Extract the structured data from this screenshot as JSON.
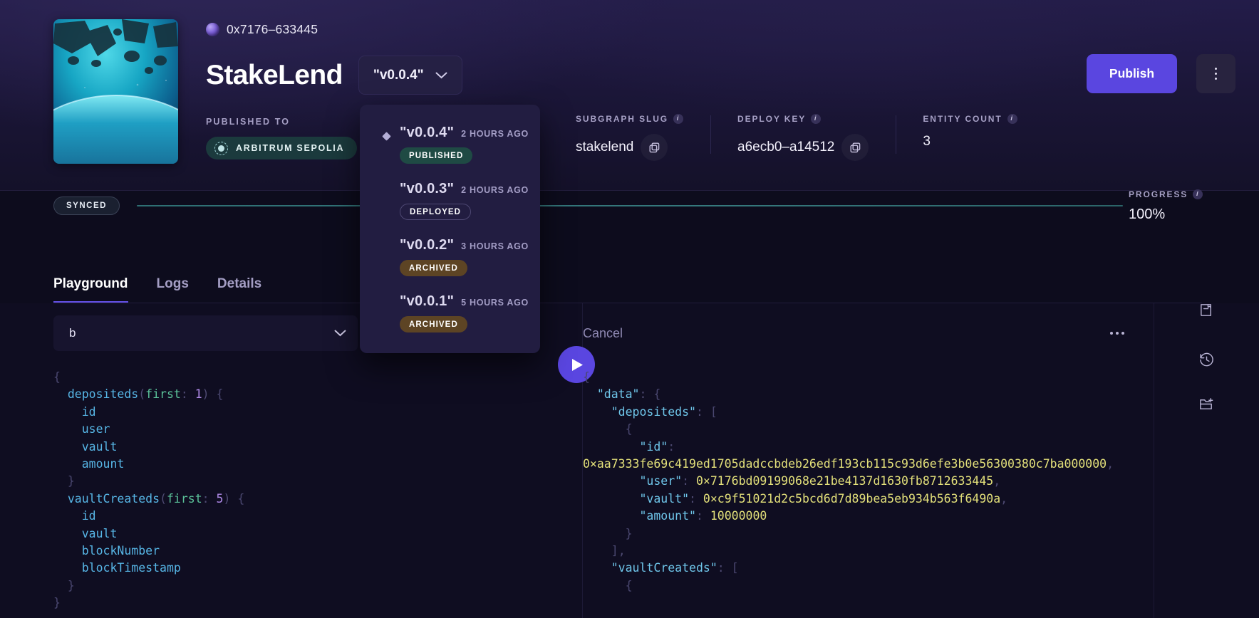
{
  "header": {
    "owner_id": "0x7176–633445",
    "owner_avatar_icon": "avatar-icon",
    "title": "StakeLend",
    "version_selector": {
      "value": "\"v0.0.4\"",
      "chevron_icon": "chevron-down-icon"
    },
    "published_to_label": "PUBLISHED TO",
    "network": {
      "name": "ARBITRUM SEPOLIA",
      "logo_icon": "arbitrum-logo-icon"
    },
    "publish_button": "Publish",
    "kebab_icon": "more-vertical-icon",
    "thumbnail_icon": "subgraph-thumbnail-image"
  },
  "meta": [
    {
      "label": "SUBGRAPH SLUG",
      "value": "stakelend",
      "info_icon": "info-icon",
      "copy_icon": "copy-icon",
      "has_copy": true
    },
    {
      "label": "DEPLOY KEY",
      "value": "a6ecb0–a14512",
      "info_icon": "info-icon",
      "copy_icon": "copy-icon",
      "has_copy": true
    },
    {
      "label": "ENTITY COUNT",
      "value": "3",
      "info_icon": "info-icon",
      "copy_icon": "copy-icon",
      "has_copy": false
    }
  ],
  "status": {
    "sync_badge": "SYNCED",
    "progress_label": "PROGRESS",
    "progress_value": "100%",
    "progress_percent": 100,
    "progress_info_icon": "info-icon"
  },
  "version_dropdown": {
    "items": [
      {
        "name": "\"v0.0.4\"",
        "time": "2 HOURS AGO",
        "badge": "PUBLISHED",
        "badge_style": "b-published",
        "selected": true
      },
      {
        "name": "\"v0.0.3\"",
        "time": "2 HOURS AGO",
        "badge": "DEPLOYED",
        "badge_style": "b-deployed",
        "selected": false
      },
      {
        "name": "\"v0.0.2\"",
        "time": "3 HOURS AGO",
        "badge": "ARCHIVED",
        "badge_style": "b-archived",
        "selected": false
      },
      {
        "name": "\"v0.0.1\"",
        "time": "5 HOURS AGO",
        "badge": "ARCHIVED",
        "badge_style": "b-archived",
        "selected": false
      }
    ]
  },
  "tabs": [
    {
      "label": "Playground",
      "active": true
    },
    {
      "label": "Logs",
      "active": false
    },
    {
      "label": "Details",
      "active": false
    }
  ],
  "playground": {
    "document_select": {
      "value": "b",
      "chevron_icon": "chevron-down-icon"
    },
    "cancel_label": "Cancel",
    "overflow_icon": "more-horizontal-icon",
    "run_icon": "play-icon",
    "query_lines": [
      "{",
      "  depositeds(first: 1) {",
      "    id",
      "    user",
      "    vault",
      "    amount",
      "  }",
      "  vaultCreateds(first: 5) {",
      "    id",
      "    vault",
      "    blockNumber",
      "    blockTimestamp",
      "  }",
      "}"
    ],
    "result_values": {
      "deposited_id": "0×aa7333fe69c419ed1705dadccbdeb26edf193cb115c93d6efe3b0e56300380c7ba000000",
      "deposited_user": "0×7176bd09199068e21be4137d1630fb8712633445",
      "deposited_vault": "0×c9f51021d2c5bcd6d7d89bea5eb934b563f6490a",
      "deposited_amount": "10000000"
    },
    "rail_buttons": [
      {
        "icon": "docs-icon"
      },
      {
        "icon": "history-icon"
      },
      {
        "icon": "new-folder-icon"
      }
    ]
  },
  "colors": {
    "accent": "#5a46e0",
    "published_badge": "#1f4a44",
    "archived_badge": "#5d4424",
    "network_chip": "#1b3a3d",
    "page_bg": "#0f0d21"
  }
}
